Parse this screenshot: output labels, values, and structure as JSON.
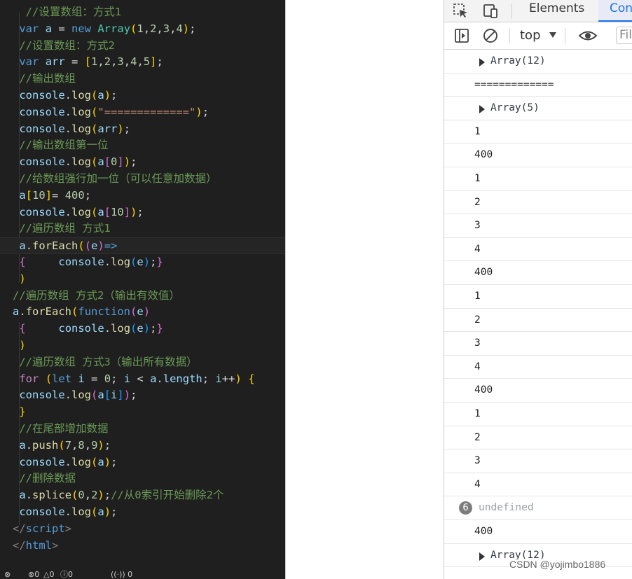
{
  "editor": {
    "lines": [
      [
        {
          "t": "  ",
          "c": "op"
        },
        {
          "t": "//设置数组：方式1",
          "c": "cm"
        }
      ],
      [
        {
          "t": " ",
          "c": "op"
        },
        {
          "t": "var",
          "c": "kw"
        },
        {
          "t": " ",
          "c": "op"
        },
        {
          "t": "a",
          "c": "id"
        },
        {
          "t": " = ",
          "c": "op"
        },
        {
          "t": "new",
          "c": "kw"
        },
        {
          "t": " ",
          "c": "op"
        },
        {
          "t": "Array",
          "c": "cls"
        },
        {
          "t": "(",
          "c": "b1"
        },
        {
          "t": "1",
          "c": "num"
        },
        {
          "t": ",",
          "c": "op"
        },
        {
          "t": "2",
          "c": "num"
        },
        {
          "t": ",",
          "c": "op"
        },
        {
          "t": "3",
          "c": "num"
        },
        {
          "t": ",",
          "c": "op"
        },
        {
          "t": "4",
          "c": "num"
        },
        {
          "t": ")",
          "c": "b1"
        },
        {
          "t": ";",
          "c": "op"
        }
      ],
      [
        {
          "t": " ",
          "c": "op"
        },
        {
          "t": "//设置数组：方式2",
          "c": "cm"
        }
      ],
      [
        {
          "t": " ",
          "c": "op"
        },
        {
          "t": "var",
          "c": "kw"
        },
        {
          "t": " ",
          "c": "op"
        },
        {
          "t": "arr",
          "c": "id"
        },
        {
          "t": " = ",
          "c": "op"
        },
        {
          "t": "[",
          "c": "b1"
        },
        {
          "t": "1",
          "c": "num"
        },
        {
          "t": ",",
          "c": "op"
        },
        {
          "t": "2",
          "c": "num"
        },
        {
          "t": ",",
          "c": "op"
        },
        {
          "t": "3",
          "c": "num"
        },
        {
          "t": ",",
          "c": "op"
        },
        {
          "t": "4",
          "c": "num"
        },
        {
          "t": ",",
          "c": "op"
        },
        {
          "t": "5",
          "c": "num"
        },
        {
          "t": "]",
          "c": "b1"
        },
        {
          "t": ";",
          "c": "op"
        }
      ],
      [
        {
          "t": " ",
          "c": "op"
        },
        {
          "t": "//输出数组",
          "c": "cm"
        }
      ],
      [
        {
          "t": " ",
          "c": "op"
        },
        {
          "t": "console",
          "c": "id"
        },
        {
          "t": ".",
          "c": "op"
        },
        {
          "t": "log",
          "c": "fn"
        },
        {
          "t": "(",
          "c": "b1"
        },
        {
          "t": "a",
          "c": "id"
        },
        {
          "t": ")",
          "c": "b1"
        },
        {
          "t": ";",
          "c": "op"
        }
      ],
      [
        {
          "t": " ",
          "c": "op"
        },
        {
          "t": "console",
          "c": "id"
        },
        {
          "t": ".",
          "c": "op"
        },
        {
          "t": "log",
          "c": "fn"
        },
        {
          "t": "(",
          "c": "b1"
        },
        {
          "t": "\"=============\"",
          "c": "str"
        },
        {
          "t": ")",
          "c": "b1"
        },
        {
          "t": ";",
          "c": "op"
        }
      ],
      [
        {
          "t": " ",
          "c": "op"
        },
        {
          "t": "console",
          "c": "id"
        },
        {
          "t": ".",
          "c": "op"
        },
        {
          "t": "log",
          "c": "fn"
        },
        {
          "t": "(",
          "c": "b1"
        },
        {
          "t": "arr",
          "c": "id"
        },
        {
          "t": ")",
          "c": "b1"
        },
        {
          "t": ";",
          "c": "op"
        }
      ],
      [
        {
          "t": " ",
          "c": "op"
        },
        {
          "t": "//输出数组第一位",
          "c": "cm"
        }
      ],
      [
        {
          "t": " ",
          "c": "op"
        },
        {
          "t": "console",
          "c": "id"
        },
        {
          "t": ".",
          "c": "op"
        },
        {
          "t": "log",
          "c": "fn"
        },
        {
          "t": "(",
          "c": "b1"
        },
        {
          "t": "a",
          "c": "id"
        },
        {
          "t": "[",
          "c": "b2"
        },
        {
          "t": "0",
          "c": "num"
        },
        {
          "t": "]",
          "c": "b2"
        },
        {
          "t": ")",
          "c": "b1"
        },
        {
          "t": ";",
          "c": "op"
        }
      ],
      [
        {
          "t": " ",
          "c": "op"
        },
        {
          "t": "//给数组强行加一位（可以任意加数据）",
          "c": "cm"
        }
      ],
      [
        {
          "t": " ",
          "c": "op"
        },
        {
          "t": "a",
          "c": "id"
        },
        {
          "t": "[",
          "c": "b1"
        },
        {
          "t": "10",
          "c": "num"
        },
        {
          "t": "]",
          "c": "b1"
        },
        {
          "t": "= ",
          "c": "op"
        },
        {
          "t": "400",
          "c": "num"
        },
        {
          "t": ";",
          "c": "op"
        }
      ],
      [
        {
          "t": " ",
          "c": "op"
        },
        {
          "t": "console",
          "c": "id"
        },
        {
          "t": ".",
          "c": "op"
        },
        {
          "t": "log",
          "c": "fn"
        },
        {
          "t": "(",
          "c": "b1"
        },
        {
          "t": "a",
          "c": "id"
        },
        {
          "t": "[",
          "c": "b2"
        },
        {
          "t": "10",
          "c": "num"
        },
        {
          "t": "]",
          "c": "b2"
        },
        {
          "t": ")",
          "c": "b1"
        },
        {
          "t": ";",
          "c": "op"
        }
      ],
      [
        {
          "t": " ",
          "c": "op"
        },
        {
          "t": "//遍历数组 方式1",
          "c": "cm"
        }
      ],
      [
        {
          "t": " ",
          "c": "op"
        },
        {
          "t": "a",
          "c": "id"
        },
        {
          "t": ".",
          "c": "op"
        },
        {
          "t": "forEach",
          "c": "fn"
        },
        {
          "t": "(",
          "c": "b1"
        },
        {
          "t": "(",
          "c": "b2"
        },
        {
          "t": "e",
          "c": "id"
        },
        {
          "t": ")",
          "c": "b2"
        },
        {
          "t": "=>",
          "c": "kw"
        }
      ],
      [
        {
          "t": " ",
          "c": "op"
        },
        {
          "t": "{",
          "c": "b2"
        },
        {
          "t": "     ",
          "c": "op"
        },
        {
          "t": "console",
          "c": "id"
        },
        {
          "t": ".",
          "c": "op"
        },
        {
          "t": "log",
          "c": "fn"
        },
        {
          "t": "(",
          "c": "b3"
        },
        {
          "t": "e",
          "c": "id"
        },
        {
          "t": ")",
          "c": "b3"
        },
        {
          "t": ";",
          "c": "op"
        },
        {
          "t": "}",
          "c": "b2"
        }
      ],
      [
        {
          "t": " ",
          "c": "op"
        },
        {
          "t": ")",
          "c": "b1"
        }
      ],
      [
        {
          "t": "//遍历数组 方式2（输出有效值）",
          "c": "cm"
        }
      ],
      [
        {
          "t": "a",
          "c": "id"
        },
        {
          "t": ".",
          "c": "op"
        },
        {
          "t": "forEach",
          "c": "fn"
        },
        {
          "t": "(",
          "c": "b1"
        },
        {
          "t": "function",
          "c": "kw"
        },
        {
          "t": "(",
          "c": "b2"
        },
        {
          "t": "e",
          "c": "id"
        },
        {
          "t": ")",
          "c": "b2"
        }
      ],
      [
        {
          "t": " ",
          "c": "op"
        },
        {
          "t": "{",
          "c": "b2"
        },
        {
          "t": "     ",
          "c": "op"
        },
        {
          "t": "console",
          "c": "id"
        },
        {
          "t": ".",
          "c": "op"
        },
        {
          "t": "log",
          "c": "fn"
        },
        {
          "t": "(",
          "c": "b3"
        },
        {
          "t": "e",
          "c": "id"
        },
        {
          "t": ")",
          "c": "b3"
        },
        {
          "t": ";",
          "c": "op"
        },
        {
          "t": "}",
          "c": "b2"
        }
      ],
      [
        {
          "t": " ",
          "c": "op"
        },
        {
          "t": ")",
          "c": "b1"
        }
      ],
      [
        {
          "t": " ",
          "c": "op"
        },
        {
          "t": "//遍历数组 方式3（输出所有数据）",
          "c": "cm"
        }
      ],
      [
        {
          "t": " ",
          "c": "op"
        },
        {
          "t": "for",
          "c": "ctl"
        },
        {
          "t": " ",
          "c": "op"
        },
        {
          "t": "(",
          "c": "b1"
        },
        {
          "t": "let",
          "c": "kw"
        },
        {
          "t": " ",
          "c": "op"
        },
        {
          "t": "i",
          "c": "id"
        },
        {
          "t": " = ",
          "c": "op"
        },
        {
          "t": "0",
          "c": "num"
        },
        {
          "t": "; ",
          "c": "op"
        },
        {
          "t": "i",
          "c": "id"
        },
        {
          "t": " < ",
          "c": "op"
        },
        {
          "t": "a",
          "c": "id"
        },
        {
          "t": ".",
          "c": "op"
        },
        {
          "t": "length",
          "c": "id"
        },
        {
          "t": "; ",
          "c": "op"
        },
        {
          "t": "i",
          "c": "id"
        },
        {
          "t": "++",
          "c": "op"
        },
        {
          "t": ")",
          "c": "b1"
        },
        {
          "t": " ",
          "c": "op"
        },
        {
          "t": "{",
          "c": "b1"
        }
      ],
      [
        {
          "t": " ",
          "c": "op"
        },
        {
          "t": "console",
          "c": "id"
        },
        {
          "t": ".",
          "c": "op"
        },
        {
          "t": "log",
          "c": "fn"
        },
        {
          "t": "(",
          "c": "b2"
        },
        {
          "t": "a",
          "c": "id"
        },
        {
          "t": "[",
          "c": "b3"
        },
        {
          "t": "i",
          "c": "id"
        },
        {
          "t": "]",
          "c": "b3"
        },
        {
          "t": ")",
          "c": "b2"
        },
        {
          "t": ";",
          "c": "op"
        }
      ],
      [
        {
          "t": " ",
          "c": "op"
        },
        {
          "t": "}",
          "c": "b1"
        }
      ],
      [
        {
          "t": " ",
          "c": "op"
        },
        {
          "t": "//在尾部增加数据",
          "c": "cm"
        }
      ],
      [
        {
          "t": " ",
          "c": "op"
        },
        {
          "t": "a",
          "c": "id"
        },
        {
          "t": ".",
          "c": "op"
        },
        {
          "t": "push",
          "c": "fn"
        },
        {
          "t": "(",
          "c": "b1"
        },
        {
          "t": "7",
          "c": "num"
        },
        {
          "t": ",",
          "c": "op"
        },
        {
          "t": "8",
          "c": "num"
        },
        {
          "t": ",",
          "c": "op"
        },
        {
          "t": "9",
          "c": "num"
        },
        {
          "t": ")",
          "c": "b1"
        },
        {
          "t": ";",
          "c": "op"
        }
      ],
      [
        {
          "t": " ",
          "c": "op"
        },
        {
          "t": "console",
          "c": "id"
        },
        {
          "t": ".",
          "c": "op"
        },
        {
          "t": "log",
          "c": "fn"
        },
        {
          "t": "(",
          "c": "b1"
        },
        {
          "t": "a",
          "c": "id"
        },
        {
          "t": ")",
          "c": "b1"
        },
        {
          "t": ";",
          "c": "op"
        }
      ],
      [
        {
          "t": " ",
          "c": "op"
        },
        {
          "t": "//删除数据",
          "c": "cm"
        }
      ],
      [
        {
          "t": " ",
          "c": "op"
        },
        {
          "t": "a",
          "c": "id"
        },
        {
          "t": ".",
          "c": "op"
        },
        {
          "t": "splice",
          "c": "fn"
        },
        {
          "t": "(",
          "c": "b1"
        },
        {
          "t": "0",
          "c": "num"
        },
        {
          "t": ",",
          "c": "op"
        },
        {
          "t": "2",
          "c": "num"
        },
        {
          "t": ")",
          "c": "b1"
        },
        {
          "t": ";",
          "c": "op"
        },
        {
          "t": "//从0索引开始删除2个",
          "c": "cm"
        }
      ],
      [
        {
          "t": " ",
          "c": "op"
        },
        {
          "t": "console",
          "c": "id"
        },
        {
          "t": ".",
          "c": "op"
        },
        {
          "t": "log",
          "c": "fn"
        },
        {
          "t": "(",
          "c": "b1"
        },
        {
          "t": "a",
          "c": "id"
        },
        {
          "t": ")",
          "c": "b1"
        },
        {
          "t": ";",
          "c": "op"
        }
      ],
      [
        {
          "t": "</",
          "c": "tag"
        },
        {
          "t": "script",
          "c": "tn"
        },
        {
          "t": ">",
          "c": "tag"
        }
      ],
      [
        {
          "t": "</",
          "c": "tag"
        },
        {
          "t": "html",
          "c": "tn"
        },
        {
          "t": ">",
          "c": "tag"
        }
      ]
    ]
  },
  "devtools": {
    "tabs": {
      "elements": "Elements",
      "console": "Con"
    },
    "context": "top",
    "filter_placeholder": "Fil",
    "log": [
      {
        "text": "Array(12)",
        "kind": "obj"
      },
      {
        "text": "=============",
        "kind": "plain"
      },
      {
        "text": "Array(5)",
        "kind": "obj"
      },
      {
        "text": "1",
        "kind": "plain"
      },
      {
        "text": "400",
        "kind": "plain"
      },
      {
        "text": "1",
        "kind": "plain"
      },
      {
        "text": "2",
        "kind": "plain"
      },
      {
        "text": "3",
        "kind": "plain"
      },
      {
        "text": "4",
        "kind": "plain"
      },
      {
        "text": "400",
        "kind": "plain"
      },
      {
        "text": "1",
        "kind": "plain"
      },
      {
        "text": "2",
        "kind": "plain"
      },
      {
        "text": "3",
        "kind": "plain"
      },
      {
        "text": "4",
        "kind": "plain"
      },
      {
        "text": "400",
        "kind": "plain"
      },
      {
        "text": "1",
        "kind": "plain"
      },
      {
        "text": "2",
        "kind": "plain"
      },
      {
        "text": "3",
        "kind": "plain"
      },
      {
        "text": "4",
        "kind": "plain"
      },
      {
        "text": "undefined",
        "kind": "undef",
        "count": "6"
      },
      {
        "text": "400",
        "kind": "plain"
      },
      {
        "text": "Array(12)",
        "kind": "obj"
      }
    ]
  },
  "watermark": "CSDN @yojimbo1886"
}
